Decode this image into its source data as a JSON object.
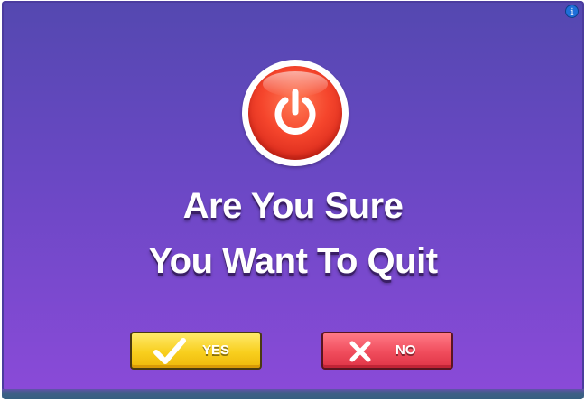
{
  "dialog": {
    "title_line1": "Are You Sure",
    "title_line2": "You Want To Quit",
    "info_icon": "info-icon",
    "power_icon": "power-icon"
  },
  "buttons": {
    "yes_label": "YES",
    "yes_icon": "checkmark-icon",
    "no_label": "NO",
    "no_icon": "x-mark-icon"
  },
  "colors": {
    "background_top": "#5448b0",
    "background_bottom": "#8a4ad8",
    "power_button": "#f5452c",
    "yes_button": "#f8cf1e",
    "no_button": "#f04c5c"
  }
}
